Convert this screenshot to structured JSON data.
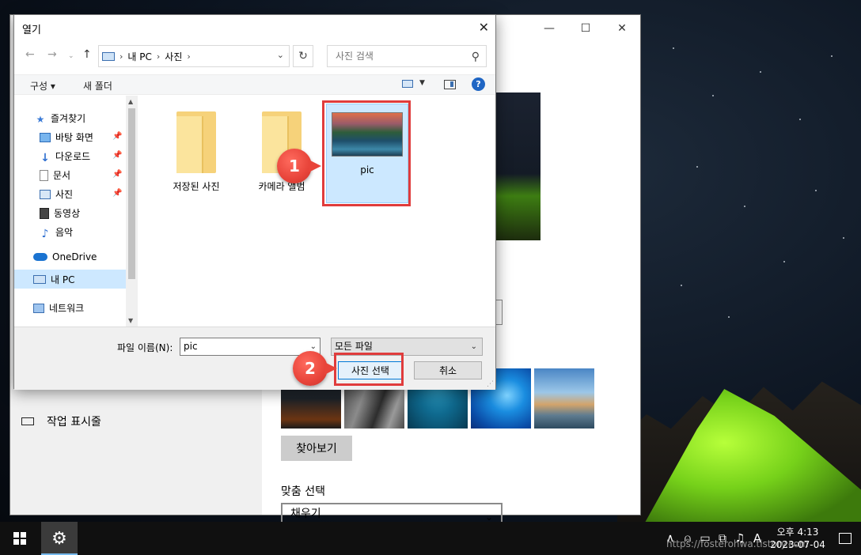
{
  "dialog": {
    "title": "열기",
    "address": {
      "crumbs": [
        "내 PC",
        "사진"
      ]
    },
    "search": {
      "placeholder": "사진 검색"
    },
    "command_bar": {
      "organize": "구성",
      "new_folder": "새 폴더"
    },
    "nav_pane": {
      "items": [
        {
          "label": "즐겨찾기",
          "icon": "star-icon"
        },
        {
          "label": "바탕 화면",
          "icon": "desktop-icon",
          "pinned": true
        },
        {
          "label": "다운로드",
          "icon": "download-icon",
          "pinned": true
        },
        {
          "label": "문서",
          "icon": "document-icon",
          "pinned": true
        },
        {
          "label": "사진",
          "icon": "pictures-icon",
          "pinned": true
        },
        {
          "label": "동영상",
          "icon": "video-icon"
        },
        {
          "label": "음악",
          "icon": "music-icon"
        },
        {
          "label": "OneDrive",
          "icon": "cloud-icon"
        },
        {
          "label": "내 PC",
          "icon": "pc-icon",
          "selected": true
        },
        {
          "label": "네트워크",
          "icon": "network-icon"
        }
      ]
    },
    "files": [
      {
        "name": "저장된 사진",
        "type": "folder"
      },
      {
        "name": "카메라 앨범",
        "type": "folder"
      },
      {
        "name": "pic",
        "type": "image",
        "selected": true
      }
    ],
    "file_name_label": "파일 이름(N):",
    "file_name_value": "pic",
    "file_type": "모든 파일",
    "open_button": "사진 선택",
    "cancel_button": "취소"
  },
  "callouts": {
    "first": "1",
    "second": "2"
  },
  "settings": {
    "taskbar_label": "작업 표시줄",
    "browse_button": "찾아보기",
    "fit_label": "맞춤 선택",
    "fit_value": "채우기"
  },
  "taskbar": {
    "clock_period_time": "오후 4:13",
    "clock_date": "2023-07-04",
    "ime_label": "A"
  },
  "watermark": "https://fosterohwa.tistory.com",
  "colors": {
    "callout": "#e8443a",
    "highlight": "#e03c3c",
    "selection": "#cce8ff",
    "accent": "#0078d7"
  }
}
